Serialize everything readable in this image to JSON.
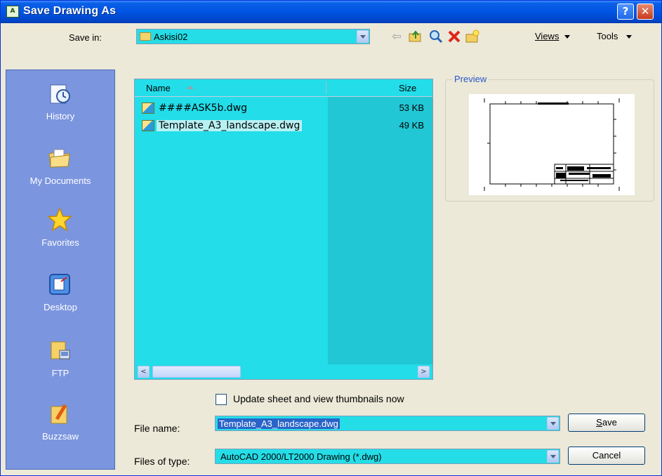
{
  "window": {
    "title": "Save Drawing As",
    "help_label": "?",
    "close_label": "✕"
  },
  "toolbar": {
    "save_in_label": "Save in:",
    "save_in_value": "Askisi02",
    "views_label": "Views",
    "tools_label": "Tools",
    "icons": [
      "back-arrow-icon",
      "up-folder-icon",
      "search-web-icon",
      "delete-icon",
      "new-folder-icon"
    ]
  },
  "places": [
    {
      "label": "History",
      "icon": "history-icon"
    },
    {
      "label": "My Documents",
      "icon": "my-documents-icon"
    },
    {
      "label": "Favorites",
      "icon": "favorites-star-icon"
    },
    {
      "label": "Desktop",
      "icon": "desktop-icon"
    },
    {
      "label": "FTP",
      "icon": "ftp-icon"
    },
    {
      "label": "Buzzsaw",
      "icon": "buzzsaw-icon"
    }
  ],
  "file_list": {
    "columns": {
      "name": "Name",
      "size": "Size"
    },
    "rows": [
      {
        "name": "####ASK5b.dwg",
        "size": "53 KB"
      },
      {
        "name": "Template_A3_landscape.dwg",
        "size": "49 KB"
      }
    ],
    "scroll_left": "<",
    "scroll_right": ">"
  },
  "preview": {
    "label": "Preview"
  },
  "options": {
    "update_thumbnails_label": "Update sheet and view thumbnails now",
    "update_thumbnails_checked": false
  },
  "file_name": {
    "label": "File name:",
    "value": "Template_A3_landscape.dwg"
  },
  "file_type": {
    "label": "Files of type:",
    "value": "AutoCAD 2000/LT2000 Drawing (*.dwg)"
  },
  "buttons": {
    "save": "Save",
    "cancel": "Cancel"
  },
  "colors": {
    "titlebar": "#0054e3",
    "places_bg": "#7b95df",
    "list_bg": "#23dde9",
    "dialog_bg": "#ece9d8"
  }
}
